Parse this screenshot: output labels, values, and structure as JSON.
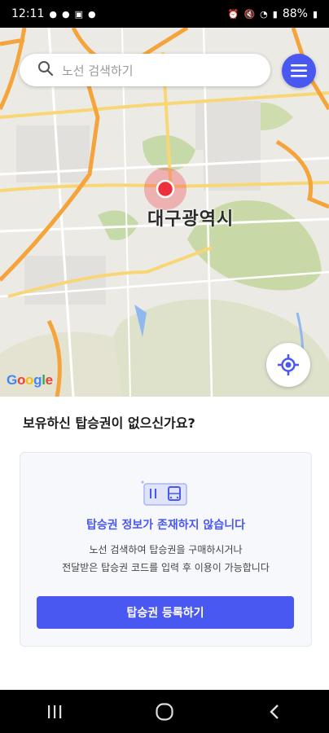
{
  "status_bar": {
    "time": "12:11",
    "battery": "88%",
    "left_icons": [
      "chat-icon",
      "messenger-icon",
      "gallery-icon",
      "pin-icon"
    ],
    "right_icons": [
      "alarm-icon",
      "mute-icon",
      "volte-icon",
      "wifi-icon",
      "signal-icon",
      "battery-icon"
    ]
  },
  "search": {
    "placeholder": "노선 검색하기"
  },
  "map": {
    "city_label": "대구광역시",
    "google_logo": "Google"
  },
  "sheet": {
    "title": "보유하신 탑승권이 없으신가요?",
    "card": {
      "icon": "ticket-bus-icon",
      "title": "탑승권 정보가 존재하지 않습니다",
      "desc_line1": "노선 검색하여 탑승권을 구매하시거나",
      "desc_line2": "전달받은 탑승권 코드를 입력 후 이용이 가능합니다",
      "button_label": "탑승권 등록하기"
    }
  },
  "colors": {
    "accent": "#4a58f2",
    "marker": "#ee2f3d"
  }
}
